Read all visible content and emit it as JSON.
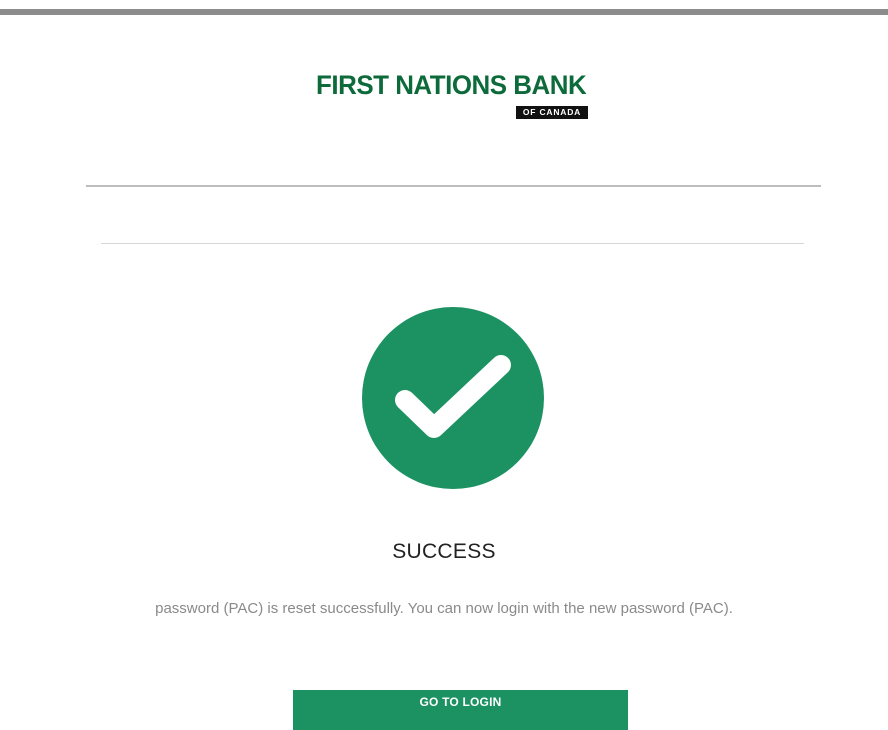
{
  "brand": {
    "name": "FIRST NATIONS BANK",
    "sub": "OF CANADA",
    "color": "#0d6a3a"
  },
  "status": {
    "icon": "checkmark-icon",
    "color": "#1c9161",
    "title": "SUCCESS",
    "message": "password (PAC) is reset successfully. You can now login with the new password (PAC)."
  },
  "actions": {
    "login_label": "GO TO LOGIN"
  }
}
